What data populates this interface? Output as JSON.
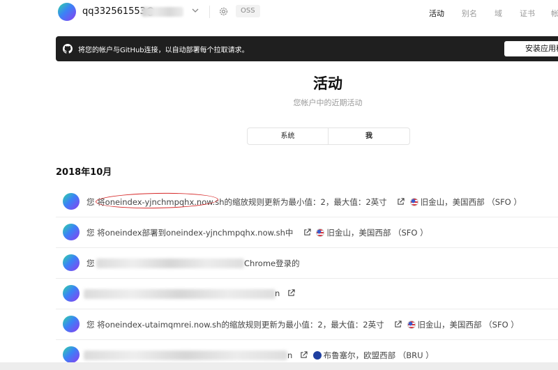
{
  "header": {
    "username": "qq332561553@",
    "oss_label": "OSS",
    "nav": [
      "活动",
      "别名",
      "域",
      "证书",
      "帐"
    ]
  },
  "banner": {
    "text": "将您的帐户与GitHub连接，以自动部署每个拉取请求。",
    "button": "安装应用程序"
  },
  "page": {
    "title": "活动",
    "subtitle": "您帐户中的近期活动"
  },
  "toggle": {
    "left": "系统",
    "right": "我"
  },
  "month": "2018年10月",
  "rows": [
    {
      "prefix": "您 将",
      "link": "oneindex-yjnchmpqhx.now.sh",
      "suffix": "的缩放规则更新为最小值：2，最大值：2英寸",
      "location": "旧金山，美国西部 （SFO ）"
    },
    {
      "prefix": "您 将oneindex部署到",
      "link": "oneindex-yjnchmpqhx.now.sh",
      "suffix": "中",
      "location": "旧金山，美国西部 （SFO ）"
    },
    {
      "prefix": "您",
      "suffix": "Chrome登录的"
    },
    {
      "suffix": "n"
    },
    {
      "prefix": "您 将",
      "link": "oneindex-utaimqmrei.now.sh",
      "suffix": "的缩放规则更新为最小值：2，最大值：2英寸",
      "location": "旧金山，美国西部 （SFO ）"
    },
    {
      "suffix": "n",
      "location": "布鲁塞尔，欧盟西部 （BRU ）"
    }
  ],
  "colors": {
    "banner_bg": "#1f1f1f",
    "accent_purple": "#8b3df0",
    "circle_annotation": "#d62828"
  }
}
